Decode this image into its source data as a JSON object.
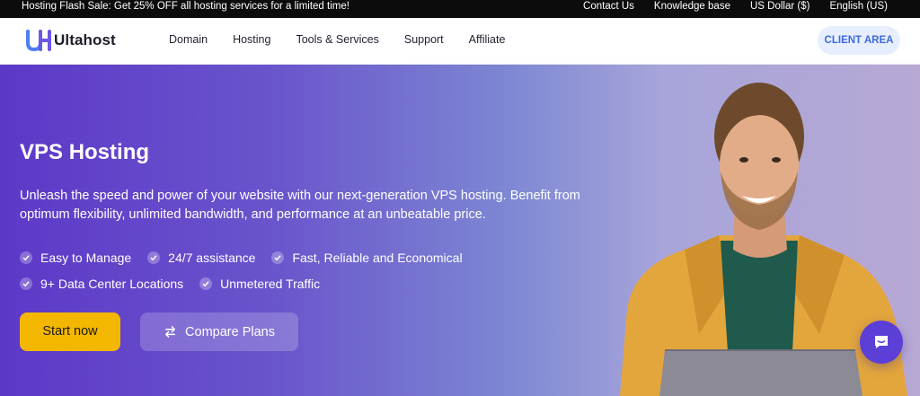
{
  "topbar": {
    "promo": "Hosting Flash Sale: Get 25% OFF all hosting services for a limited time!",
    "links": [
      "Contact Us",
      "Knowledge base",
      "US Dollar ($)",
      "English (US)"
    ]
  },
  "nav": {
    "logo_text": "Ultahost",
    "menu": [
      "Domain",
      "Hosting",
      "Tools & Services",
      "Support",
      "Affiliate"
    ],
    "client_area": "CLIENT AREA"
  },
  "hero": {
    "title": "VPS Hosting",
    "description": "Unleash the speed and power of your website with our next-generation VPS hosting. Benefit from optimum flexibility, unlimited bandwidth, and performance at an unbeatable price.",
    "features_row1": [
      "Easy to Manage",
      "24/7 assistance",
      "Fast, Reliable and Economical"
    ],
    "features_row2": [
      "9+ Data Center Locations",
      "Unmetered Traffic"
    ],
    "start_button": "Start now",
    "compare_button": "Compare Plans"
  },
  "colors": {
    "accent_yellow": "#f3b700",
    "brand_blue": "#3d6bdc",
    "hero_purple": "#5c38c7",
    "chat_purple": "#5b3fd7"
  },
  "icons": {
    "logo": "ultahost-logo-icon",
    "check": "check-icon",
    "compare": "swap-arrows-icon",
    "chat": "chat-icon"
  }
}
